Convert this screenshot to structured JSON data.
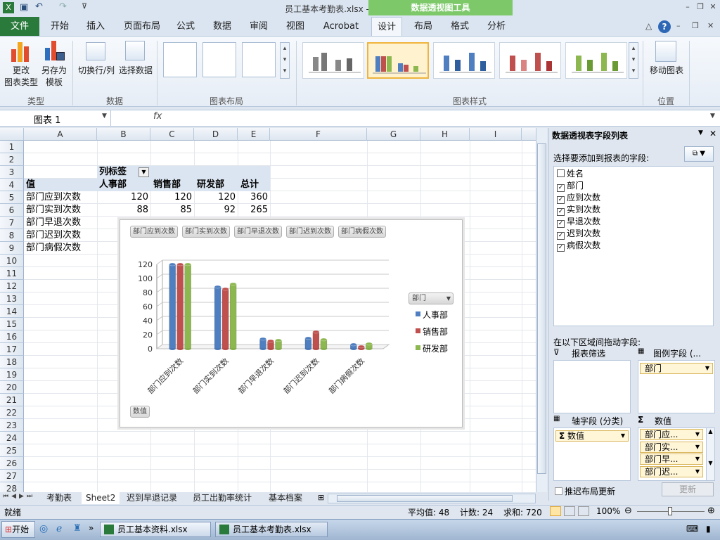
{
  "window": {
    "title": "员工基本考勤表.xlsx - Microsoft Excel",
    "context_tab": "数据透视图工具"
  },
  "tabs": [
    "文件",
    "开始",
    "插入",
    "页面布局",
    "公式",
    "数据",
    "审阅",
    "视图",
    "Acrobat",
    "设计",
    "布局",
    "格式",
    "分析"
  ],
  "ribbon": {
    "change_type": "更改\n图表类型",
    "save_template": "另存为\n模板",
    "group_type": "类型",
    "switch_row_col": "切换行/列",
    "select_data": "选择数据",
    "group_data": "数据",
    "group_layout": "图表布局",
    "group_styles": "图表样式",
    "move_chart": "移动图表",
    "group_location": "位置"
  },
  "formula_bar": {
    "name_box": "图表 1",
    "fx": "fx",
    "value": ""
  },
  "columns": [
    "A",
    "B",
    "C",
    "D",
    "E",
    "F",
    "G",
    "H",
    "I"
  ],
  "rows": [
    "1",
    "2",
    "3",
    "4",
    "5",
    "6",
    "7",
    "8",
    "9",
    "10",
    "11",
    "12",
    "13",
    "14",
    "15",
    "16",
    "17",
    "18",
    "19",
    "20",
    "21",
    "22",
    "23",
    "24",
    "25",
    "26",
    "27",
    "28"
  ],
  "pivot": {
    "col_label": "列标签",
    "value_header": "值",
    "headers": [
      "人事部",
      "销售部",
      "研发部",
      "总计"
    ],
    "rows": [
      {
        "label": "部门应到次数",
        "values": [
          "120",
          "120",
          "120",
          "360"
        ]
      },
      {
        "label": "部门实到次数",
        "values": [
          "88",
          "85",
          "92",
          "265"
        ]
      },
      {
        "label": "部门早退次数",
        "values": [
          "",
          "",
          "",
          ""
        ]
      },
      {
        "label": "部门迟到次数",
        "values": [
          "",
          "",
          "",
          ""
        ]
      },
      {
        "label": "部门病假次数",
        "values": [
          "",
          "",
          "",
          ""
        ]
      }
    ]
  },
  "chart_data": {
    "type": "bar",
    "categories": [
      "部门应到次数",
      "部门实到次数",
      "部门早退次数",
      "部门迟到次数",
      "部门病假次数"
    ],
    "series": [
      {
        "name": "人事部",
        "values": [
          120,
          88,
          14,
          15,
          6
        ],
        "color": "#4f7fc0"
      },
      {
        "name": "销售部",
        "values": [
          120,
          85,
          11,
          24,
          3
        ],
        "color": "#c0504d"
      },
      {
        "name": "研发部",
        "values": [
          120,
          92,
          12,
          13,
          7
        ],
        "color": "#8db84f"
      }
    ],
    "ylim": [
      0,
      120
    ],
    "yticks": [
      "0",
      "20",
      "40",
      "60",
      "80",
      "100",
      "120"
    ],
    "legend_title": "部门",
    "legend_position": "right",
    "grid": true,
    "field_buttons": [
      "部门应到次数",
      "部门实到次数",
      "部门早退次数",
      "部门迟到次数",
      "部门病假次数"
    ],
    "axis_button": "数值"
  },
  "field_list": {
    "title": "数据透视表字段列表",
    "prompt": "选择要添加到报表的字段:",
    "fields": [
      {
        "name": "姓名",
        "checked": false
      },
      {
        "name": "部门",
        "checked": true
      },
      {
        "name": "应到次数",
        "checked": true
      },
      {
        "name": "实到次数",
        "checked": true
      },
      {
        "name": "早退次数",
        "checked": true
      },
      {
        "name": "迟到次数",
        "checked": true
      },
      {
        "name": "病假次数",
        "checked": true
      }
    ],
    "drag_prompt": "在以下区域间拖动字段:",
    "report_filter": "报表筛选",
    "legend_fields": "图例字段 (...",
    "legend_item": "部门",
    "axis_fields": "轴字段 (分类)",
    "axis_item": "数值",
    "values_label": "数值",
    "value_items": [
      "部门应...",
      "部门实...",
      "部门早...",
      "部门迟..."
    ],
    "defer_update": "推迟布局更新",
    "update_button": "更新"
  },
  "sheet_tabs": [
    "考勤表",
    "Sheet2",
    "迟到早退记录",
    "员工出勤率统计",
    "基本档案"
  ],
  "status": {
    "ready": "就绪",
    "average": "平均值: 48",
    "count": "计数: 24",
    "sum": "求和: 720",
    "zoom": "100%"
  },
  "taskbar": {
    "start": "开始",
    "items": [
      "员工基本资料.xlsx",
      "员工基本考勤表.xlsx"
    ]
  }
}
